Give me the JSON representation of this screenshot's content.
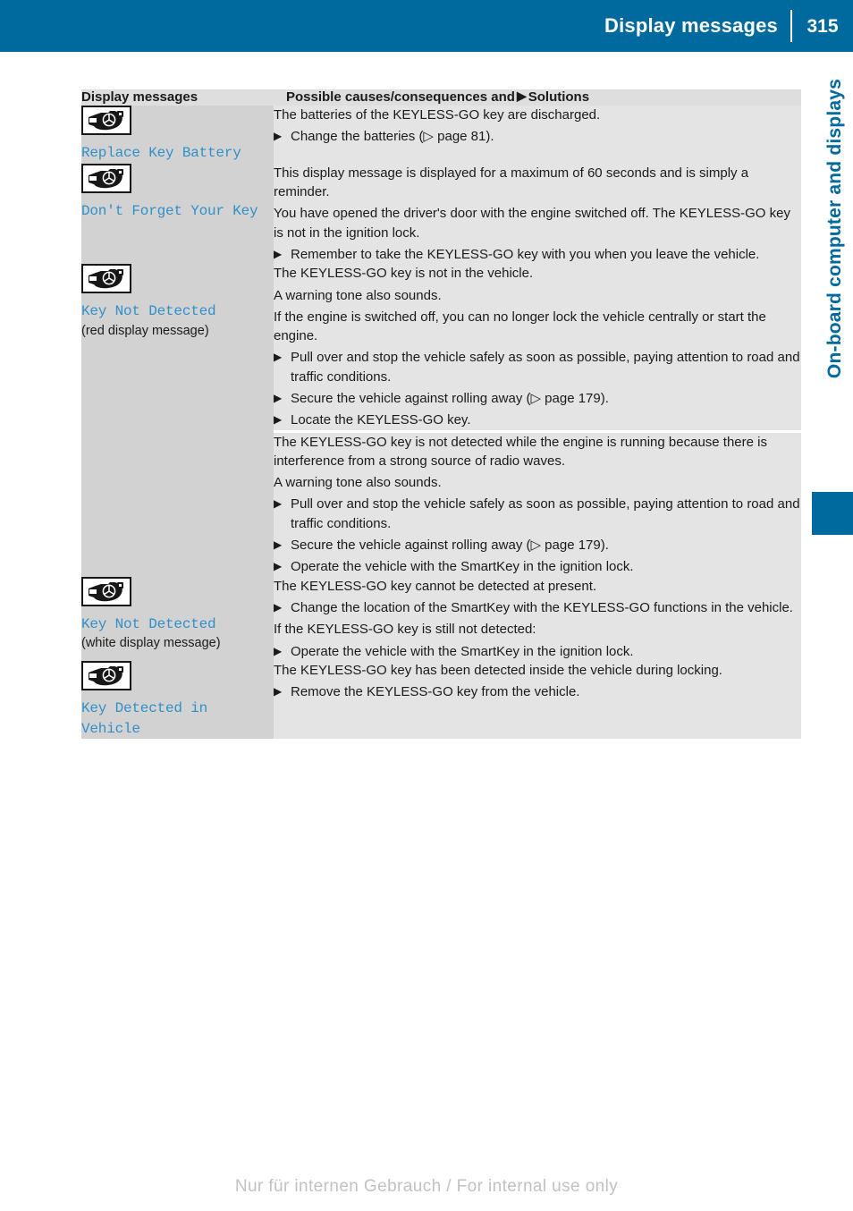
{
  "header": {
    "title": "Display messages",
    "page_number": "315"
  },
  "side_tab": {
    "chapter_label": "On-board computer and displays"
  },
  "table": {
    "columns": {
      "left_header": "Display messages",
      "right_header_before": "Possible causes/consequences and",
      "right_header_arrow": "▶",
      "right_header_after": "Solutions"
    },
    "rows": [
      {
        "icon": "keyless-go-key-icon",
        "message": "Replace Key Battery",
        "note": "",
        "blocks": [
          {
            "type": "paragraphs",
            "paragraphs": [
              "The batteries of the KEYLESS-GO key are discharged."
            ],
            "bullets": [
              "Change the batteries (▷ page 81)."
            ]
          }
        ]
      },
      {
        "icon": "keyless-go-key-icon",
        "message": "Don't Forget Your Key",
        "note": "",
        "blocks": [
          {
            "type": "paragraphs",
            "paragraphs": [
              "This display message is displayed for a maximum of 60 seconds and is simply a reminder.",
              "You have opened the driver's door with the engine switched off. The KEYLESS-GO key is not in the ignition lock."
            ],
            "bullets": [
              "Remember to take the KEYLESS-GO key with you when you leave the vehicle."
            ]
          }
        ]
      },
      {
        "icon": "keyless-go-key-icon",
        "message": "Key Not Detected",
        "note": "(red display message)",
        "blocks": [
          {
            "type": "paragraphs",
            "paragraphs": [
              "The KEYLESS-GO key is not in the vehicle.",
              "A warning tone also sounds.",
              "If the engine is switched off, you can no longer lock the vehicle centrally or start the engine."
            ],
            "bullets": [
              "Pull over and stop the vehicle safely as soon as possible, paying attention to road and traffic conditions.",
              "Secure the vehicle against rolling away (▷ page 179).",
              "Locate the KEYLESS-GO key."
            ]
          },
          {
            "type": "paragraphs",
            "paragraphs": [
              "The KEYLESS-GO key is not detected while the engine is running because there is interference from a strong source of radio waves.",
              "A warning tone also sounds."
            ],
            "bullets": [
              "Pull over and stop the vehicle safely as soon as possible, paying attention to road and traffic conditions.",
              "Secure the vehicle against rolling away (▷ page 179).",
              "Operate the vehicle with the SmartKey in the ignition lock."
            ]
          }
        ]
      },
      {
        "icon": "keyless-go-key-icon",
        "message": "Key Not Detected",
        "note": "(white display message)",
        "blocks": [
          {
            "type": "mixed",
            "paragraphs": [
              "The KEYLESS-GO key cannot be detected at present."
            ],
            "bullets": [
              "Change the location of the SmartKey with the KEYLESS-GO functions in the vehicle."
            ],
            "paragraphs2": [
              "If the KEYLESS-GO key is still not detected:"
            ],
            "bullets2": [
              "Operate the vehicle with the SmartKey in the ignition lock."
            ]
          }
        ]
      },
      {
        "icon": "keyless-go-key-icon",
        "message": "Key Detected in Vehicle",
        "note": "",
        "blocks": [
          {
            "type": "paragraphs",
            "paragraphs": [
              "The KEYLESS-GO key has been detected inside the vehicle during locking."
            ],
            "bullets": [
              "Remove the KEYLESS-GO key from the vehicle."
            ]
          }
        ]
      }
    ]
  },
  "footer": {
    "text": "Nur für internen Gebrauch / For internal use only"
  },
  "colors": {
    "brand_blue": "#006a9e",
    "message_blue": "#3090c7",
    "left_cell_gray": "#d2d2d2",
    "right_cell_gray": "#e4e4e4",
    "header_cell_gray": "#dedede"
  }
}
